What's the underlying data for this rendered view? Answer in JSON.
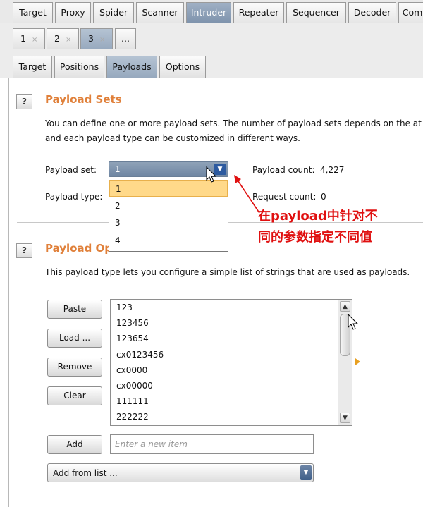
{
  "top_tabs": [
    "Target",
    "Proxy",
    "Spider",
    "Scanner",
    "Intruder",
    "Repeater",
    "Sequencer",
    "Decoder",
    "Com"
  ],
  "active_top_tab": "Intruder",
  "number_tabs": [
    {
      "label": "1",
      "close": "×"
    },
    {
      "label": "2",
      "close": "×"
    },
    {
      "label": "3",
      "close": "×"
    },
    {
      "label": "...",
      "close": ""
    }
  ],
  "sub_tabs": [
    "Target",
    "Positions",
    "Payloads",
    "Options"
  ],
  "active_sub_tab": "Payloads",
  "help_label": "?",
  "payload_sets": {
    "title": "Payload Sets",
    "desc_line1": "You can define one or more payload sets. The number of payload sets depends on the at",
    "desc_line2": "and each payload type can be customized in different ways.",
    "payload_set_label": "Payload set:",
    "payload_set_value": "1",
    "payload_set_options": [
      "1",
      "2",
      "3",
      "4"
    ],
    "payload_type_label": "Payload type:",
    "payload_count_label": "Payload count:",
    "payload_count_value": "4,227",
    "request_count_label": "Request count:",
    "request_count_value": "0"
  },
  "payload_options": {
    "title": "Payload Op",
    "desc": "This payload type lets you configure a simple list of strings that are used as payloads.",
    "buttons": {
      "paste": "Paste",
      "load": "Load ...",
      "remove": "Remove",
      "clear": "Clear",
      "add": "Add"
    },
    "items": [
      "123",
      "123456",
      "123654",
      "cx0123456",
      "cx0000",
      "cx00000",
      "111111",
      "222222"
    ],
    "new_item_placeholder": "Enter a new item",
    "add_from_list": "Add from list ..."
  },
  "annotation": {
    "line1": "在payload中针对不",
    "line2": "同的参数指定不同值",
    "color": "#e01010"
  },
  "colors": {
    "section_title": "#e0803a",
    "active_tab": "#7f94ad",
    "selected_option": "#ffd98a"
  }
}
